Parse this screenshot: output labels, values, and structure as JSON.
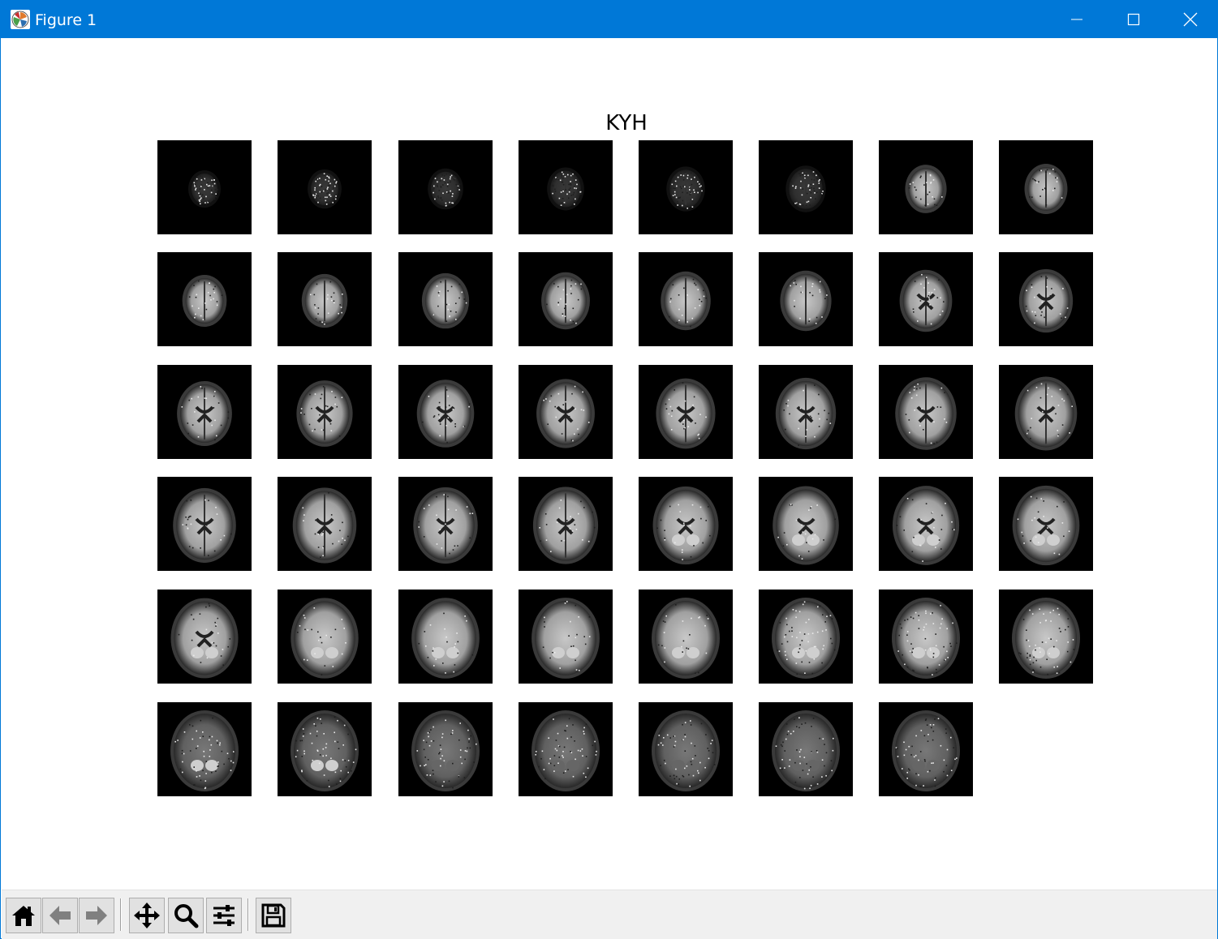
{
  "window": {
    "title": "Figure 1",
    "icons": {
      "app": "matplotlib-figure-icon",
      "minimize": "minimize-icon",
      "maximize": "maximize-icon",
      "close": "close-icon"
    }
  },
  "figure": {
    "title": "KYH",
    "grid": {
      "rows": 6,
      "cols": 8,
      "panel_count": 47
    },
    "colormap": "gray",
    "background": "#000000"
  },
  "toolbar": {
    "buttons": [
      {
        "name": "home-button",
        "icon": "home-icon"
      },
      {
        "name": "back-button",
        "icon": "back-arrow-icon"
      },
      {
        "name": "forward-button",
        "icon": "forward-arrow-icon"
      },
      {
        "name": "pan-button",
        "icon": "move-icon"
      },
      {
        "name": "zoom-button",
        "icon": "zoom-icon"
      },
      {
        "name": "configure-subplots-button",
        "icon": "sliders-icon"
      },
      {
        "name": "save-button",
        "icon": "save-icon"
      }
    ]
  },
  "colors": {
    "titlebar": "#0078d7",
    "toolbar": "#f0f0f0"
  }
}
